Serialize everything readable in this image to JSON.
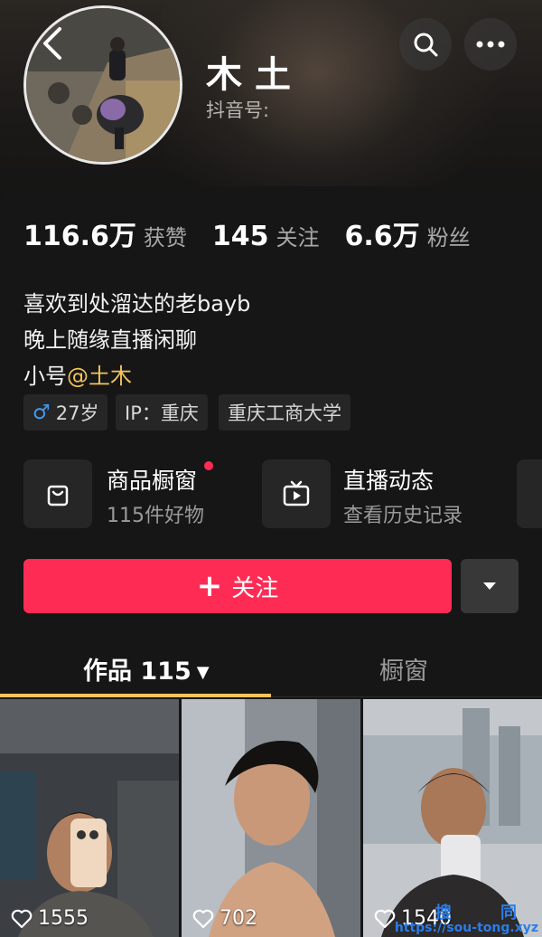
{
  "profile": {
    "name": "木土",
    "douyin_id_label": "抖音号:"
  },
  "stats": [
    {
      "num": "116.6万",
      "label": "获赞"
    },
    {
      "num": "145",
      "label": "关注"
    },
    {
      "num": "6.6万",
      "label": "粉丝"
    }
  ],
  "bio": {
    "line1": "喜欢到处溜达的老bayb",
    "line2": "晚上随缘直播闲聊",
    "line3_prefix": "小号",
    "line3_mention": "@土木"
  },
  "tags": {
    "gender_icon": "♂",
    "age": "27岁",
    "ip": "IP：重庆",
    "school": "重庆工商大学"
  },
  "features": [
    {
      "title": "商品橱窗",
      "subtitle": "115件好物",
      "icon": "shopping-bag-icon"
    },
    {
      "title": "直播动态",
      "subtitle": "查看历史记录",
      "icon": "tv-icon"
    }
  ],
  "actions": {
    "follow_label": "关注"
  },
  "tabs": {
    "works_label": "作品 115",
    "window_label": "橱窗"
  },
  "videos": [
    {
      "likes": "1555"
    },
    {
      "likes": "702"
    },
    {
      "likes": "1540"
    }
  ],
  "watermark": {
    "line1": "搜 同",
    "line2": "https://sou-tong.xyz"
  },
  "colors": {
    "accent": "#fe2c55",
    "mention": "#f2c45a",
    "male": "#3f9bf5"
  }
}
